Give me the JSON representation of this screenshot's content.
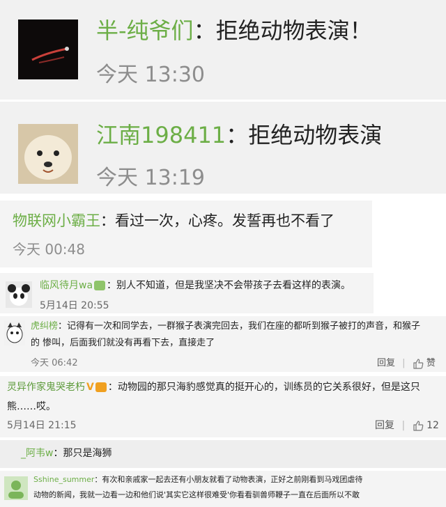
{
  "comments": [
    {
      "user": "半-纯爷们",
      "sep": "：",
      "text": "拒绝动物表演！",
      "time": "今天 13:30"
    },
    {
      "user": "江南198411",
      "sep": "：",
      "text": "拒绝动物表演",
      "time": "今天 13:19"
    },
    {
      "user": "物联网小霸王",
      "sep": "：",
      "text": "看过一次，心疼。发誓再也不看了",
      "time": "今天 00:48"
    },
    {
      "user": "临风待月wa",
      "sep": "：",
      "text": "别人不知道，但是我坚决不会带孩子去看这样的表演。",
      "time": "5月14日 20:55"
    },
    {
      "user": "虎纠榜",
      "sep": "：",
      "text_line1": "记得有一次和同学去，一群猴子表演完回去，我们在座的都听到猴子被打的声音，和猴子",
      "text_line2": "的 惨叫，后面我们就没有再看下去，直接走了",
      "time": "今天 06:42",
      "reply": "回复",
      "like": "赞"
    },
    {
      "user": "灵异作家鬼哭老朽",
      "sep": "：",
      "text_line1": "动物园的那只海豹感觉真的挺开心的，训练员的它关系很好，但是这只",
      "text_line2": "熊……哎。",
      "time": "5月14日 21:15",
      "reply": "回复",
      "like_count": "12"
    },
    {
      "user": "_阿韦w",
      "sep": "：",
      "text": "那只是海狮"
    },
    {
      "user": "Sshine_summer",
      "sep": "：",
      "text_line1": "有次和亲戚家一起去还有小朋友就看了动物表演，正好之前刚看到马戏团虐待",
      "text_line2": "动物的新闻，我就一边看一边和他们说'其实它这样很难受'你看看驯兽师鞭子一直在后面所以不敢"
    }
  ],
  "colors": {
    "username": "#6cae46",
    "text": "#222222",
    "time": "#8d8d8d"
  }
}
